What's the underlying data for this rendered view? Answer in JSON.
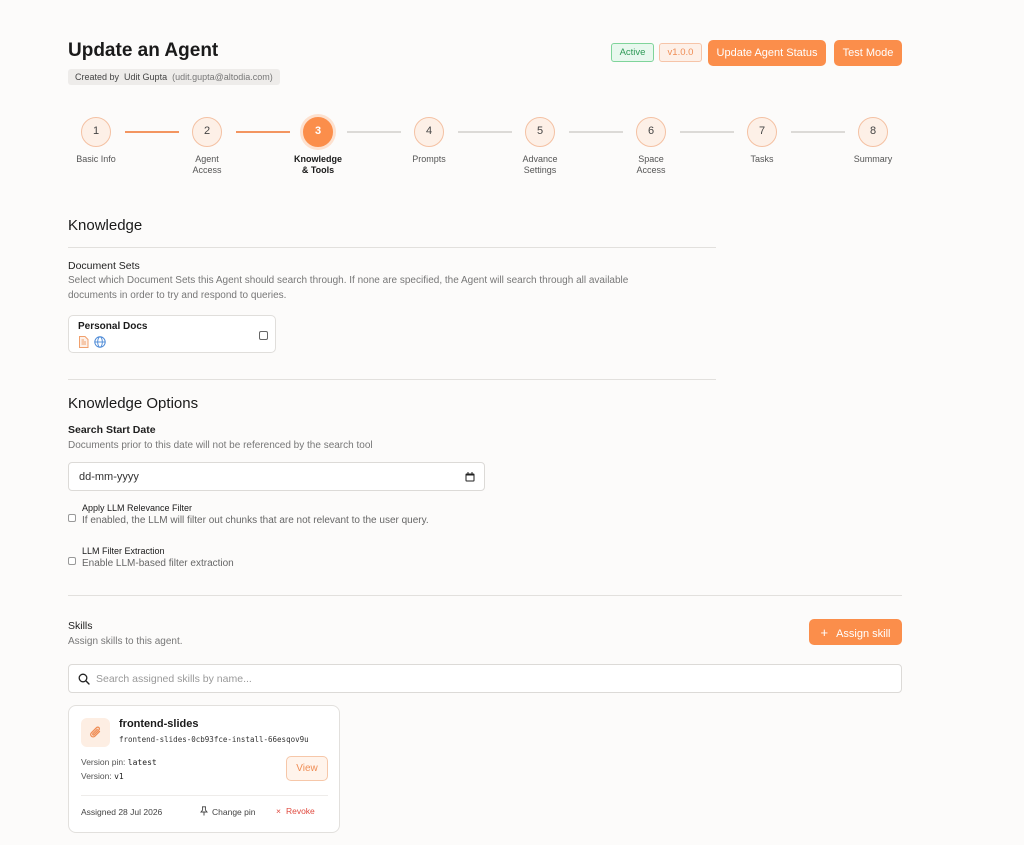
{
  "header": {
    "title": "Update an Agent",
    "created_by_label": "Created by",
    "creator_name": "Udit Gupta",
    "creator_email": "(udit.gupta@altodia.com)",
    "status_badge": "Active",
    "version_badge": "v1.0.0",
    "update_status_button": "Update Agent Status",
    "test_mode_button": "Test Mode"
  },
  "stepper": {
    "steps": [
      {
        "number": "1",
        "label": "Basic Info"
      },
      {
        "number": "2",
        "label": "Agent Access"
      },
      {
        "number": "3",
        "label": "Knowledge & Tools"
      },
      {
        "number": "4",
        "label": "Prompts"
      },
      {
        "number": "5",
        "label": "Advance Settings"
      },
      {
        "number": "6",
        "label": "Space Access"
      },
      {
        "number": "7",
        "label": "Tasks"
      },
      {
        "number": "8",
        "label": "Summary"
      }
    ],
    "active_index": 2
  },
  "knowledge": {
    "title": "Knowledge",
    "document_sets_label": "Document Sets",
    "document_sets_desc_line1": "Select which Document Sets this Agent should search through. If none are specified, the Agent will search through all available",
    "document_sets_desc_line2": "documents in order to try and respond to queries.",
    "doc_card_title": "Personal Docs"
  },
  "knowledge_options": {
    "title": "Knowledge Options",
    "search_start_label": "Search Start Date",
    "search_start_desc": "Documents prior to this date will not be referenced by the search tool",
    "date_placeholder": "dd-mm-yyyy",
    "relevance_title": "Apply LLM Relevance Filter",
    "relevance_desc": "If enabled, the LLM will filter out chunks that are not relevant to the user query.",
    "extraction_title": "LLM Filter Extraction",
    "extraction_desc": "Enable LLM-based filter extraction"
  },
  "skills": {
    "title": "Skills",
    "desc": "Assign skills to this agent.",
    "assign_button": "Assign skill",
    "search_placeholder": "Search assigned skills by name...",
    "card": {
      "name": "frontend-slides",
      "slug": "frontend-slides-0cb93fce-install-66esqov9u",
      "version_pin_label": "Version pin:",
      "version_pin_value": "latest",
      "version_label": "Version:",
      "version_value": "v1",
      "view_button": "View",
      "assigned": "Assigned 28 Jul 2026",
      "change_pin": "Change pin",
      "revoke": "Revoke"
    }
  },
  "colors": {
    "accent": "#fb8e4b",
    "active_green": "#2f9a57",
    "revoke_red": "#e04a3f"
  }
}
